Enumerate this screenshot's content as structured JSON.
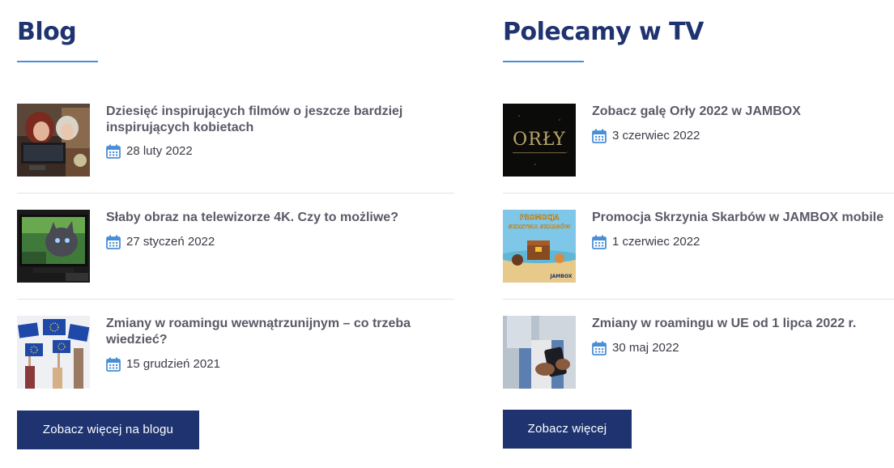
{
  "blog": {
    "title": "Blog",
    "items": [
      {
        "title": "Dziesięć inspirujących filmów o jeszcze bardziej inspirujących kobietach",
        "date": "28 luty 2022"
      },
      {
        "title": "Słaby obraz na telewizorze 4K. Czy to możliwe?",
        "date": "27 styczeń 2022"
      },
      {
        "title": "Zmiany w roamingu wewnątrzunijnym – co trzeba wiedzieć?",
        "date": "15 grudzień 2021"
      }
    ],
    "button_label": "Zobacz więcej na blogu"
  },
  "tv": {
    "title": "Polecamy w TV",
    "items": [
      {
        "title": "Zobacz galę Orły 2022 w JAMBOX",
        "date": "3 czerwiec 2022",
        "thumb_text": "ORŁY"
      },
      {
        "title": "Promocja Skrzynia Skarbów w JAMBOX mobile",
        "date": "1 czerwiec 2022",
        "thumb_text_top": "PROMOCJA",
        "thumb_text_mid": "SKRZYNIA SKARBÓW",
        "thumb_text_brand": "JAMBOX"
      },
      {
        "title": "Zmiany w roamingu w UE od 1 lipca 2022 r.",
        "date": "30 maj 2022"
      }
    ],
    "button_label": "Zobacz więcej"
  },
  "colors": {
    "heading": "#1e3370",
    "accent_line": "#4a8fd6",
    "button_bg": "#1e3370",
    "item_title": "#5a5a68",
    "calendar_icon": "#4a8fd6"
  },
  "icons": {
    "date": "calendar-icon"
  }
}
